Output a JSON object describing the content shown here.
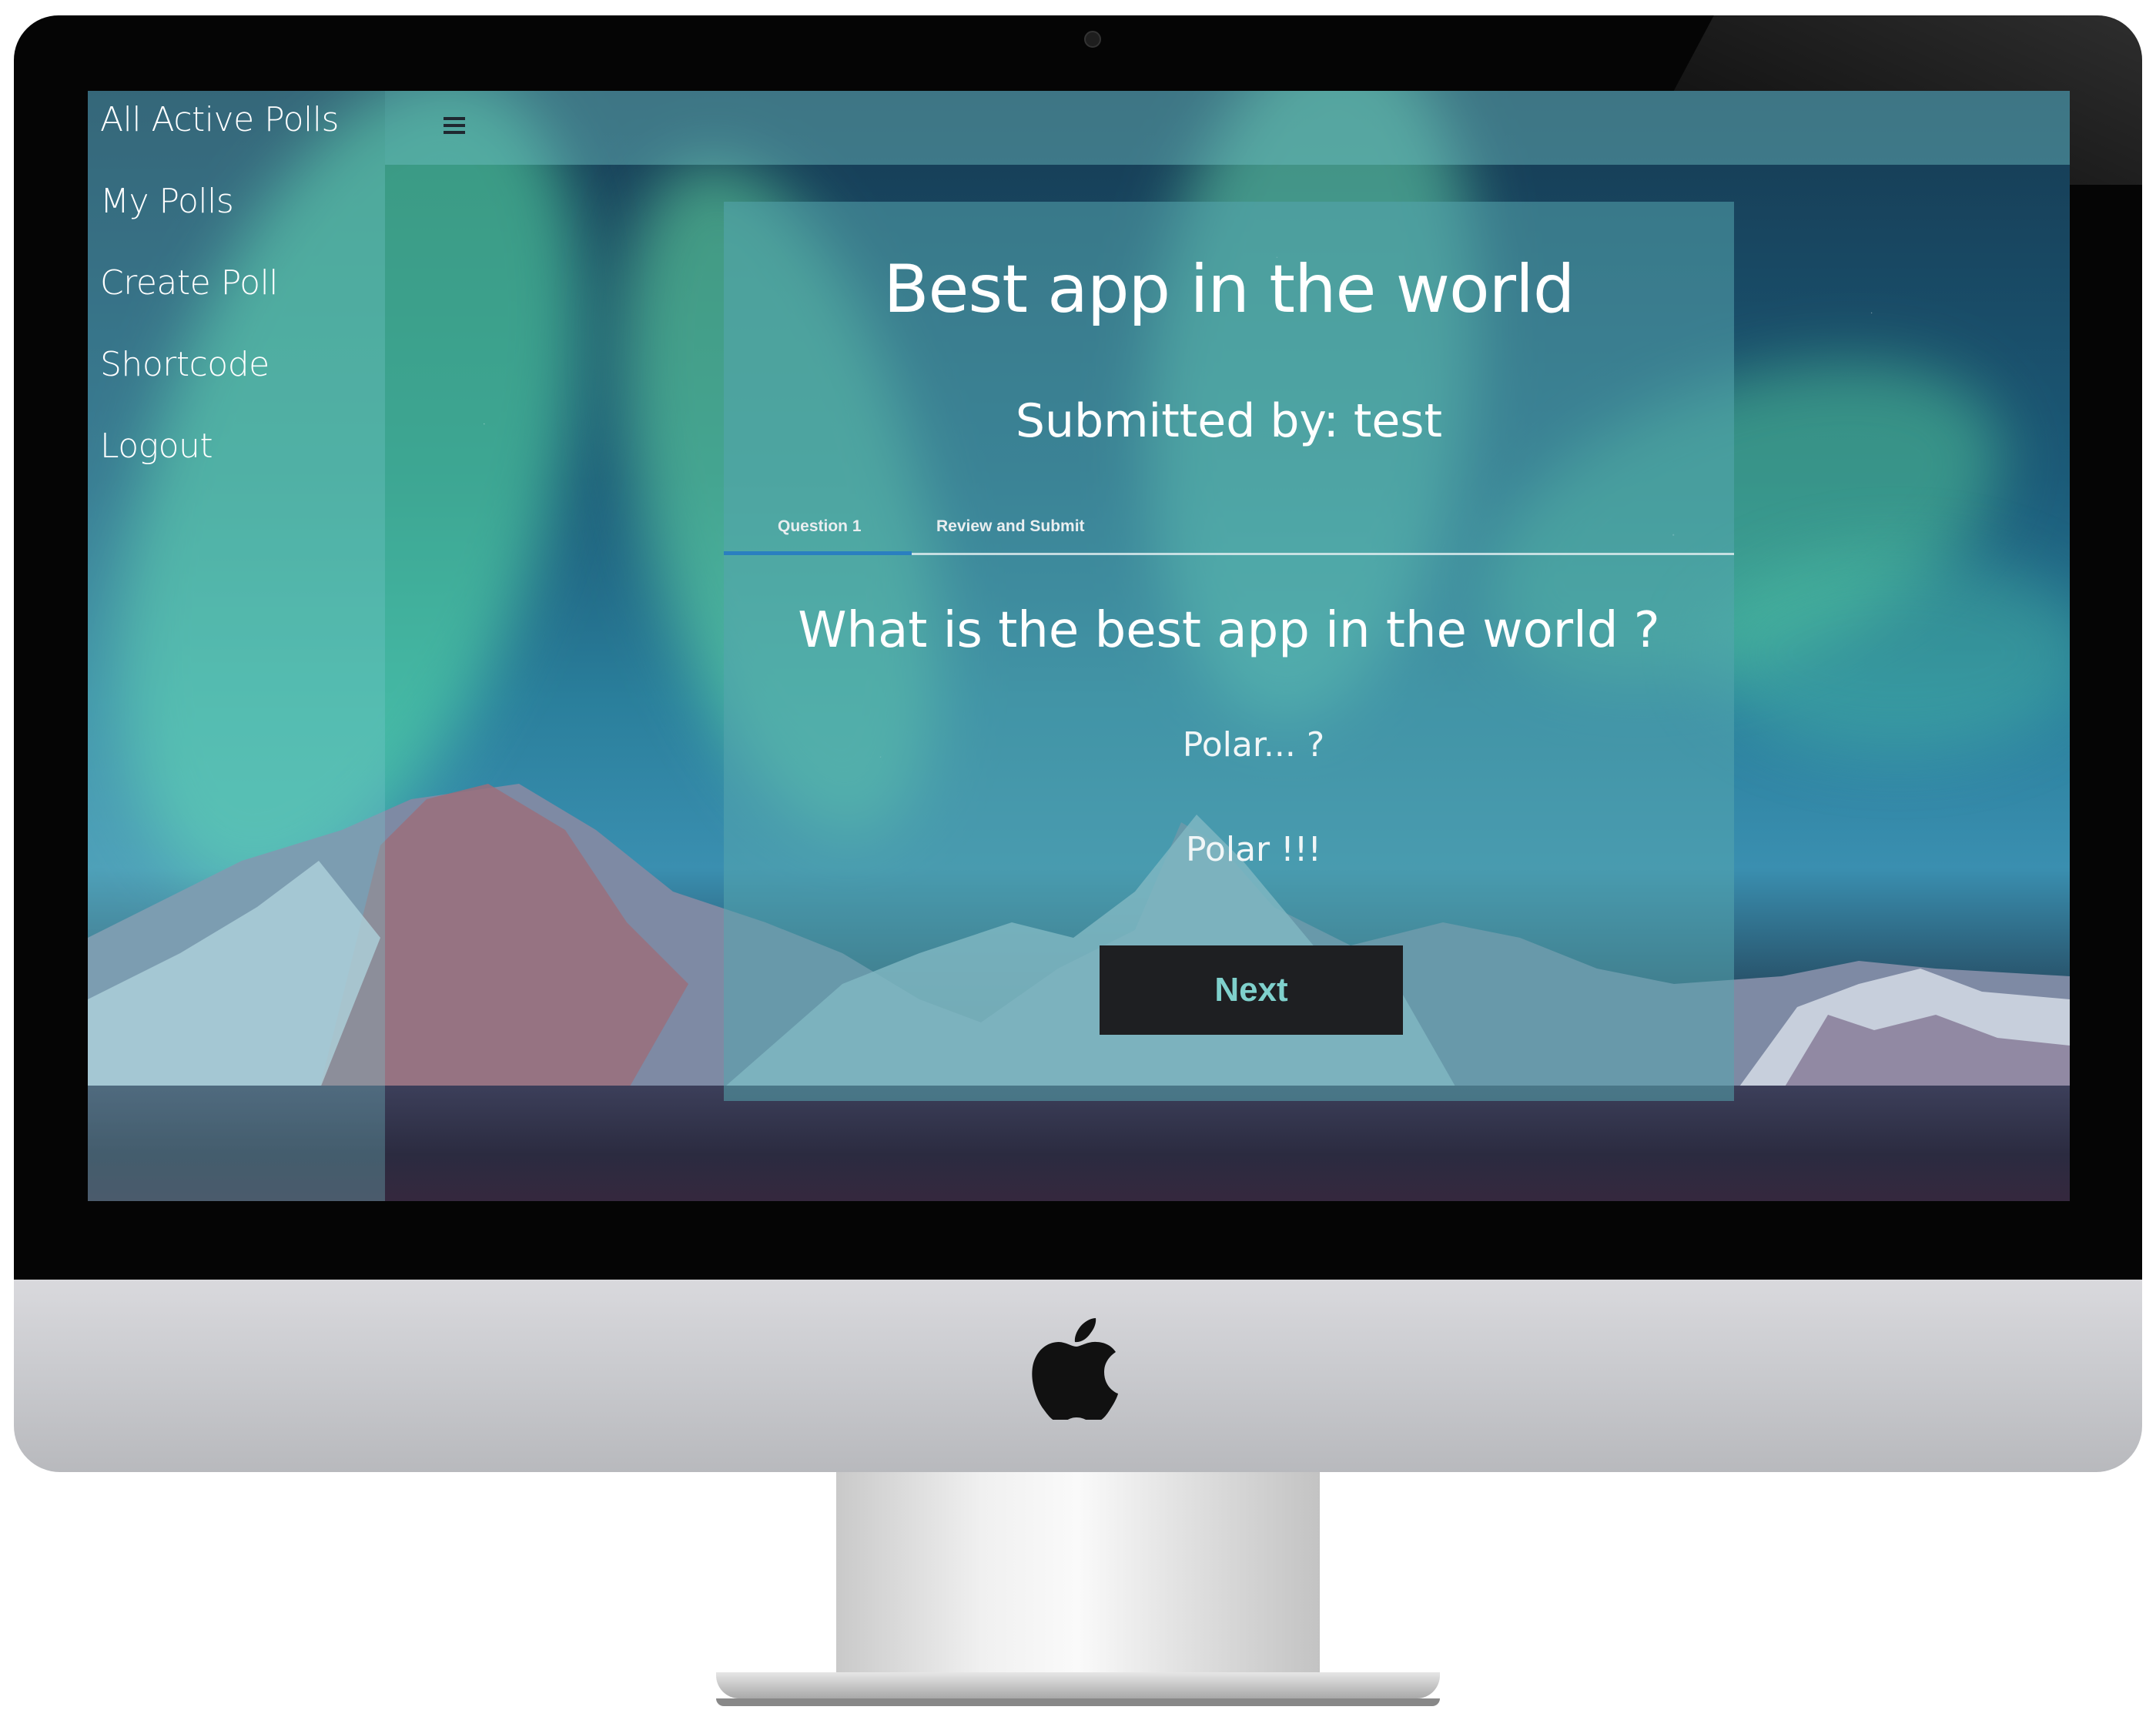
{
  "sidebar": {
    "items": [
      {
        "label": "All Active Polls"
      },
      {
        "label": "My Polls"
      },
      {
        "label": "Create Poll"
      },
      {
        "label": "Shortcode"
      },
      {
        "label": "Logout"
      }
    ]
  },
  "topbar": {
    "menu_icon": "hamburger-menu-icon"
  },
  "poll": {
    "title": "Best app in the world",
    "submitted_by": "Submitted by: test",
    "tabs": [
      {
        "label": "Question 1"
      },
      {
        "label": "Review and Submit"
      }
    ],
    "question": "What is the best app in the world ?",
    "options": [
      {
        "label": "Polar... ?"
      },
      {
        "label": "Polar !!!"
      }
    ],
    "next_label": "Next"
  },
  "colors": {
    "accent_tab": "#2a7fc0",
    "button_bg": "#1e1f22",
    "button_text": "#7fd0cc"
  },
  "device": {
    "logo": "apple-logo-icon"
  }
}
